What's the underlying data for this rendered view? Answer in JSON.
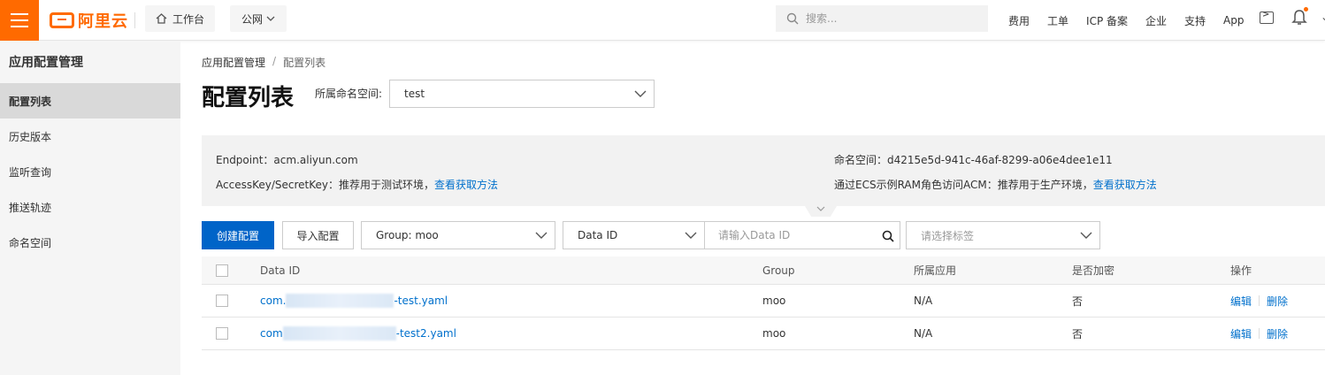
{
  "topbar": {
    "logo_text": "阿里云",
    "workbench": "工作台",
    "region": "公网",
    "search_placeholder": "搜索...",
    "nav": [
      "费用",
      "工单",
      "ICP 备案",
      "企业",
      "支持",
      "App"
    ]
  },
  "sidebar": {
    "title": "应用配置管理",
    "items": [
      {
        "label": "配置列表",
        "active": true
      },
      {
        "label": "历史版本"
      },
      {
        "label": "监听查询"
      },
      {
        "label": "推送轨迹"
      },
      {
        "label": "命名空间"
      }
    ]
  },
  "breadcrumb": {
    "root": "应用配置管理",
    "separator": "/",
    "current": "配置列表"
  },
  "page": {
    "title": "配置列表",
    "namespace_label": "所属命名空间:",
    "namespace_value": "test"
  },
  "info": {
    "endpoint_label": "Endpoint：",
    "endpoint_value": "acm.aliyun.com",
    "ak_label": "AccessKey/SecretKey：",
    "ak_text": "推荐用于测试环境，",
    "ak_link": "查看获取方法",
    "ns_label": "命名空间：",
    "ns_value": "d4215e5d-941c-46af-8299-a06e4dee1e11",
    "ecs_label": "通过ECS示例RAM角色访问ACM：",
    "ecs_text": "推荐用于生产环境，",
    "ecs_link": "查看获取方法"
  },
  "toolbar": {
    "create": "创建配置",
    "import": "导入配置",
    "group_select": "Group: moo",
    "field_select": "Data ID",
    "dataid_placeholder": "请输入Data ID",
    "tag_placeholder": "请选择标签"
  },
  "table": {
    "headers": {
      "dataid": "Data ID",
      "group": "Group",
      "app": "所属应用",
      "encrypted": "是否加密",
      "ops": "操作"
    },
    "rows": [
      {
        "dataid_prefix": "com.",
        "dataid_suffix": "-test.yaml",
        "group": "moo",
        "app": "N/A",
        "encrypted": "否",
        "edit": "编辑",
        "delete": "删除"
      },
      {
        "dataid_prefix": "com",
        "dataid_suffix": "-test2.yaml",
        "group": "moo",
        "app": "N/A",
        "encrypted": "否",
        "edit": "编辑",
        "delete": "删除"
      }
    ]
  },
  "colors": {
    "brand": "#ff6a00",
    "primary": "#0064c8",
    "link": "#0070cc"
  }
}
